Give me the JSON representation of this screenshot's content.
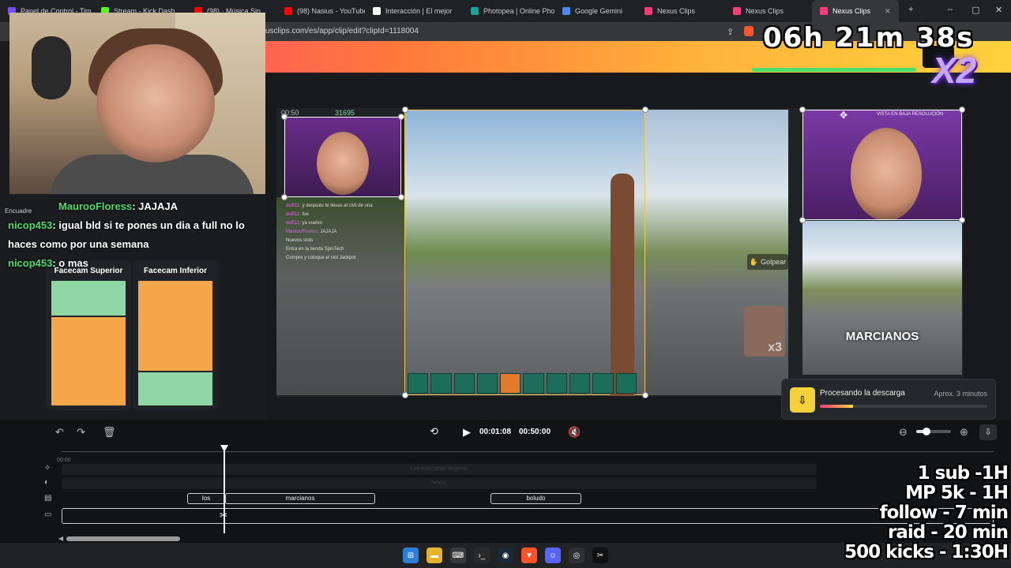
{
  "browser": {
    "tabs": [
      {
        "label": "Panel de Control - Tim",
        "color": "#7a4cff"
      },
      {
        "label": "Stream - Kick Dash",
        "color": "#53fc18"
      },
      {
        "label": "(98) · Música Sin",
        "color": "#ff0000"
      },
      {
        "label": "(98) Nasius - YouTube",
        "color": "#ff0000"
      },
      {
        "label": "Interacción | El mejor",
        "color": "#ffffff"
      },
      {
        "label": "Photopea | Online Pho",
        "color": "#18a497"
      },
      {
        "label": "Google Gemini",
        "color": "#4c8bf5"
      },
      {
        "label": "Nexus Clips",
        "color": "#ff3b7a"
      },
      {
        "label": "Nexus Clips",
        "color": "#ff3b7a"
      },
      {
        "label": "Nexus Clips",
        "color": "#ff3b7a"
      }
    ],
    "active_tab_index": 9,
    "url": "usclips.com/es/app/clip/edit?clipId=1118004",
    "new_tab_label": "+",
    "min_label": "–",
    "max_label": "▢",
    "close_label": "✕"
  },
  "stream": {
    "timer": "06h 21m 38s",
    "multiplier": "X2",
    "goals": [
      "1 sub -1H",
      "MP 5k - 1H",
      "follow - 7 min",
      "raid - 20 min",
      "500 kicks - 1:30H"
    ]
  },
  "chat": [
    {
      "user": "MaurooFloress",
      "text": ": JAJAJA"
    },
    {
      "user": "nicop453",
      "text": ": igual bld si te pones un dia a full no lo haces como por una semana"
    },
    {
      "user": "nicop453",
      "text": ": o mas"
    }
  ],
  "left_sidebar": {
    "cards": [
      {
        "label": "Facecam Superior"
      },
      {
        "label": "Facecam Inferior"
      }
    ],
    "partial_label": "Encuadre"
  },
  "canvas": {
    "game_chat": [
      {
        "user": "delfi11",
        "text": ": y después te llevas al civil de una"
      },
      {
        "user": "delfi11",
        "text": ": fue"
      },
      {
        "user": "delfi11",
        "text": ": ya vuelvo"
      },
      {
        "user": "MaurooFloress",
        "text": ": JAJAJA"
      },
      {
        "user": "",
        "text": "Nuevos slots"
      },
      {
        "user": "",
        "text": "Entra en la tienda SpinTech"
      },
      {
        "user": "",
        "text": "Compre y coloque el slot Jackpot"
      }
    ],
    "hud_time": "00:50",
    "hud_money": "31695",
    "action_label": "Golpear",
    "low_res_label": "VISTA EN BAJA RESOLUCIÓN",
    "caption": "MARCIANOS",
    "combo": "x3"
  },
  "download": {
    "title": "Procesando la descarga",
    "eta": "Aprox. 3 minutos",
    "progress": 0.2
  },
  "player": {
    "current_time": "00:01:08",
    "total_time": "00:50:00",
    "zoom": 0.3
  },
  "timeline": {
    "ruler_start": "00:00",
    "faded_tracks": [
      "Los marcianos llegaron",
      "Nexus"
    ],
    "subtitle_clips": [
      {
        "label": "los"
      },
      {
        "label": "marcianos"
      },
      {
        "label": "boludo"
      }
    ]
  },
  "taskbar": {
    "apps": [
      "windows-icon",
      "file-explorer-icon",
      "terminal-icon",
      "cmd-icon",
      "steam-icon",
      "brave-icon",
      "discord-icon",
      "obs-icon",
      "capcut-icon"
    ]
  }
}
